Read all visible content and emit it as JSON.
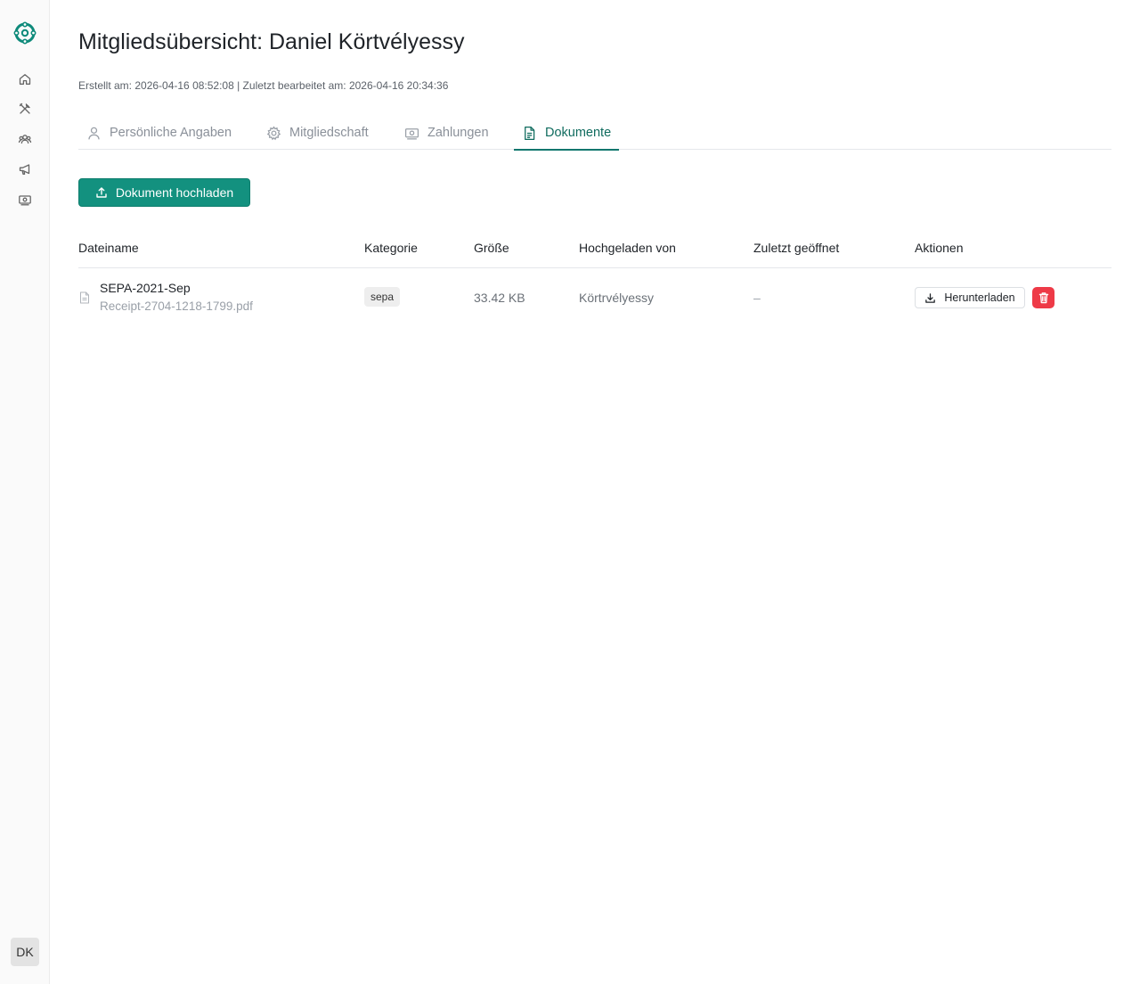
{
  "colors": {
    "accent": "#13917f",
    "accent_dark": "#0f6b5e",
    "danger": "#ee3a47",
    "sidebar_bg": "#fafafa"
  },
  "sidebar": {
    "items": [
      {
        "name": "home-icon"
      },
      {
        "name": "tools-icon"
      },
      {
        "name": "members-icon"
      },
      {
        "name": "megaphone-icon"
      },
      {
        "name": "money-icon"
      }
    ],
    "avatar": "DK"
  },
  "header": {
    "title": "Mitgliedsübersicht: Daniel Körtvélyessy",
    "meta": "Erstellt am: 2026-04-16 08:52:08 | Zuletzt bearbeitet am: 2026-04-16 20:34:36"
  },
  "tabs": [
    {
      "label": "Persönliche Angaben",
      "icon": "user-icon",
      "active": false
    },
    {
      "label": "Mitgliedschaft",
      "icon": "gear-icon",
      "active": false
    },
    {
      "label": "Zahlungen",
      "icon": "money-icon",
      "active": false
    },
    {
      "label": "Dokumente",
      "icon": "document-icon",
      "active": true
    }
  ],
  "upload_button": {
    "label": "Dokument hochladen",
    "icon": "upload-icon"
  },
  "table": {
    "columns": [
      "Dateiname",
      "Kategorie",
      "Größe",
      "Hochgeladen von",
      "Zuletzt geöffnet",
      "Aktionen"
    ],
    "rows": [
      {
        "title": "SEPA-2021-Sep",
        "filename": "Receipt-2704-1218-1799.pdf",
        "category": "sepa",
        "size": "33.42 KB",
        "uploaded_by": "Körtrvélyessy",
        "last_opened": "–",
        "download_label": "Herunterladen"
      }
    ]
  }
}
